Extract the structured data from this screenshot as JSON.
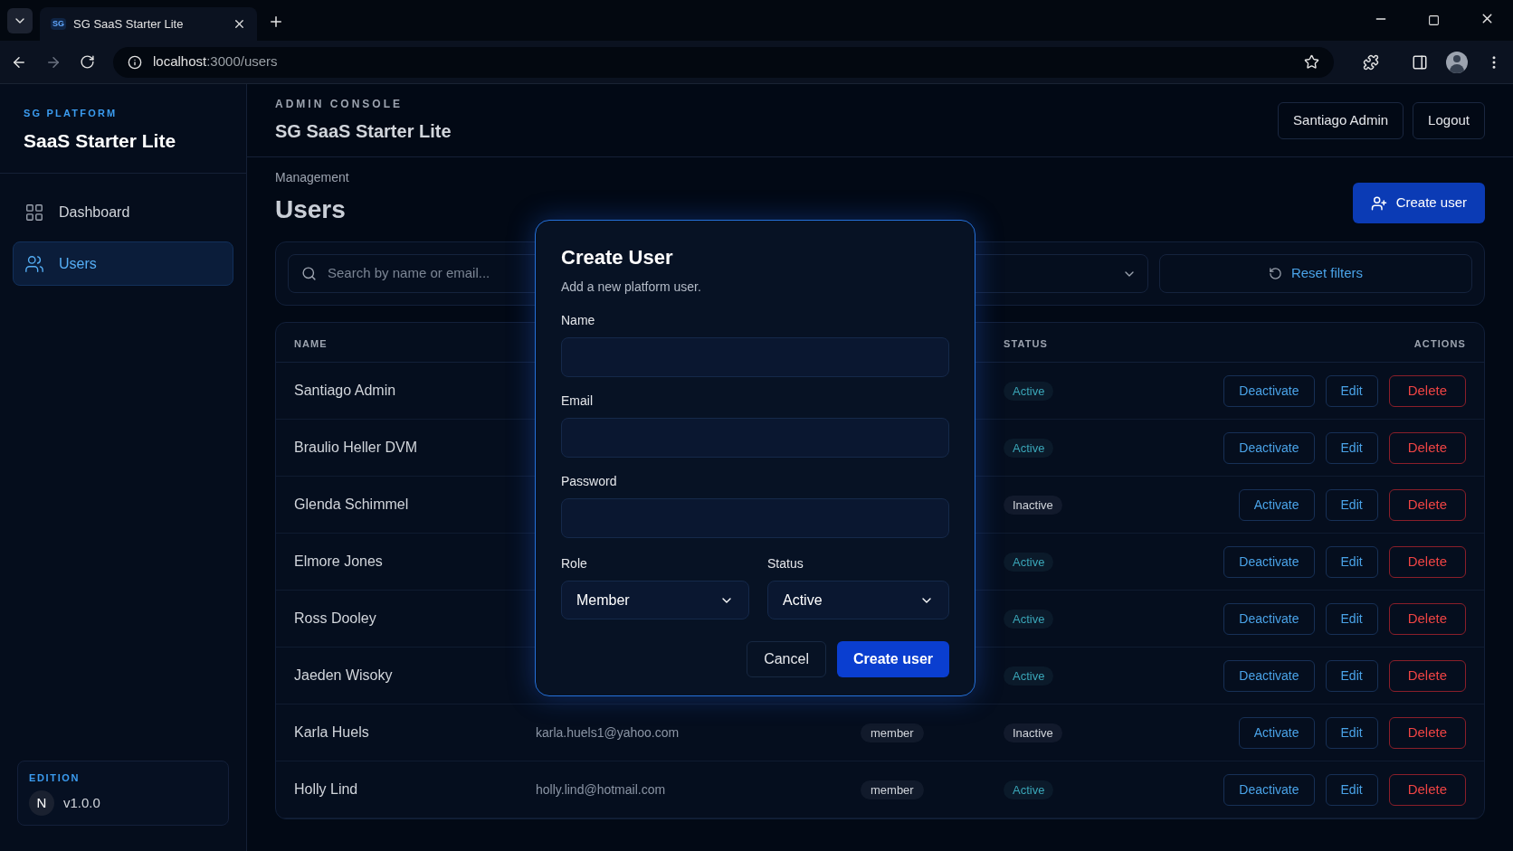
{
  "browser": {
    "tab_title": "SG SaaS Starter Lite",
    "tab_favicon": "SG",
    "url_host": "localhost",
    "url_path": ":3000/users"
  },
  "sidebar": {
    "brand_kicker": "SG PLATFORM",
    "brand_title": "SaaS Starter Lite",
    "items": [
      {
        "label": "Dashboard",
        "selected": false
      },
      {
        "label": "Users",
        "selected": true
      }
    ],
    "edition": {
      "label": "EDITION",
      "avatar": "N",
      "version": "v1.0.0"
    }
  },
  "header": {
    "kicker": "ADMIN CONSOLE",
    "title": "SG SaaS Starter Lite",
    "user_button": "Santiago Admin",
    "logout_button": "Logout"
  },
  "page": {
    "breadcrumb": "Management",
    "title": "Users",
    "create_button": "Create user"
  },
  "filters": {
    "search_placeholder": "Search by name or email...",
    "reset_button": "Reset filters"
  },
  "table": {
    "columns": [
      {
        "label": "NAME"
      },
      {},
      {},
      {
        "label": "STATUS"
      },
      {
        "label": "ACTIONS"
      }
    ],
    "rows": [
      {
        "name": "Santiago Admin",
        "status": "Active",
        "active": true,
        "toggle": "Deactivate",
        "edit": "Edit",
        "delete": "Delete"
      },
      {
        "name": "Braulio Heller DVM",
        "status": "Active",
        "active": true,
        "toggle": "Deactivate",
        "edit": "Edit",
        "delete": "Delete"
      },
      {
        "name": "Glenda Schimmel",
        "status": "Inactive",
        "active": false,
        "toggle": "Activate",
        "edit": "Edit",
        "delete": "Delete"
      },
      {
        "name": "Elmore Jones",
        "status": "Active",
        "active": true,
        "toggle": "Deactivate",
        "edit": "Edit",
        "delete": "Delete"
      },
      {
        "name": "Ross Dooley",
        "status": "Active",
        "active": true,
        "toggle": "Deactivate",
        "edit": "Edit",
        "delete": "Delete"
      },
      {
        "name": "Jaeden Wisoky",
        "status": "Active",
        "active": true,
        "toggle": "Deactivate",
        "edit": "Edit",
        "delete": "Delete"
      },
      {
        "name": "Karla Huels",
        "email": "karla.huels1@yahoo.com",
        "role": "member",
        "status": "Inactive",
        "active": false,
        "toggle": "Activate",
        "edit": "Edit",
        "delete": "Delete"
      },
      {
        "name": "Holly Lind",
        "email": "holly.lind@hotmail.com",
        "role": "member",
        "status": "Active",
        "active": true,
        "toggle": "Deactivate",
        "edit": "Edit",
        "delete": "Delete"
      }
    ]
  },
  "modal": {
    "title": "Create User",
    "subtitle": "Add a new platform user.",
    "fields": [
      {
        "label": "Name"
      },
      {
        "label": "Email"
      },
      {
        "label": "Password"
      }
    ],
    "selects": [
      {
        "label": "Role",
        "value": "Member"
      },
      {
        "label": "Status",
        "value": "Active"
      }
    ],
    "cancel_button": "Cancel",
    "submit_button": "Create user"
  }
}
